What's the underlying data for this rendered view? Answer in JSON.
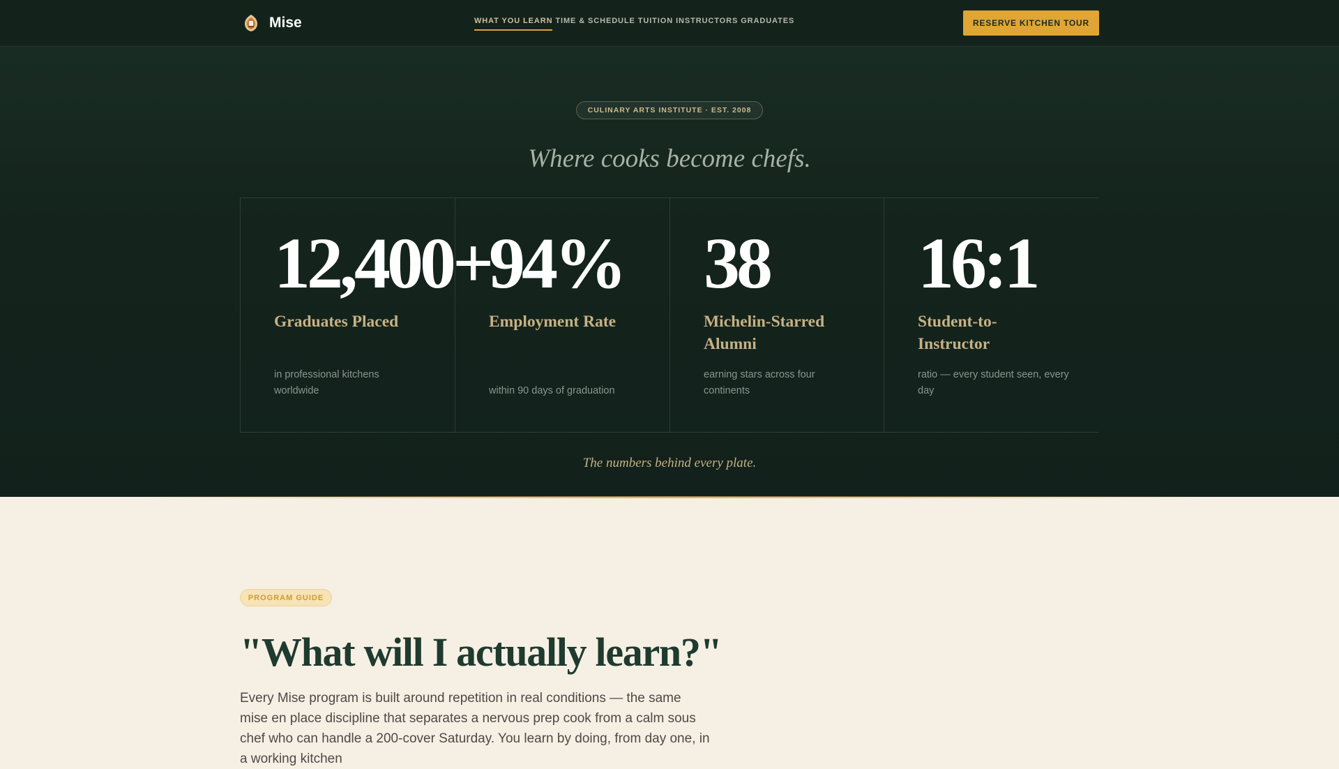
{
  "brand": {
    "name": "Mise",
    "logo_icon": "toque-emblem-icon"
  },
  "nav": {
    "links": [
      {
        "label": "WHAT YOU LEARN",
        "active": true
      },
      {
        "label": "TIME & SCHEDULE",
        "active": false
      },
      {
        "label": "TUITION",
        "active": false
      },
      {
        "label": "INSTRUCTORS",
        "active": false
      },
      {
        "label": "GRADUATES",
        "active": false
      }
    ],
    "cta": "RESERVE KITCHEN TOUR"
  },
  "hero": {
    "eyebrow": "CULINARY ARTS INSTITUTE · EST. 2008",
    "tagline": "Where cooks become chefs.",
    "stats": [
      {
        "value": "12,400+",
        "label": "Graduates Placed",
        "description": "in professional kitchens worldwide"
      },
      {
        "value": "94%",
        "label": "Employment Rate",
        "description": "within 90 days of graduation"
      },
      {
        "value": "38",
        "label": "Michelin-Starred Alumni",
        "description": "earning stars across four continents"
      },
      {
        "value": "16:1",
        "label": "Student-to-Instructor",
        "description": "ratio — every student seen, every day"
      }
    ],
    "caption": "The numbers behind every plate."
  },
  "program": {
    "badge": "PROGRAM GUIDE",
    "title": "\"What will I actually learn?\"",
    "body": "Every Mise program is built around repetition in real conditions — the same mise en place discipline that separates a nervous prep cook from a calm sous chef who can handle a 200-cover Saturday. You learn by doing, from day one, in a working kitchen"
  },
  "colors": {
    "hero_background": "#14241d",
    "accent_gold": "#e0a534",
    "label_tan": "#c7b184",
    "page_cream": "#f6efe4",
    "title_green": "#1f3a2e"
  }
}
